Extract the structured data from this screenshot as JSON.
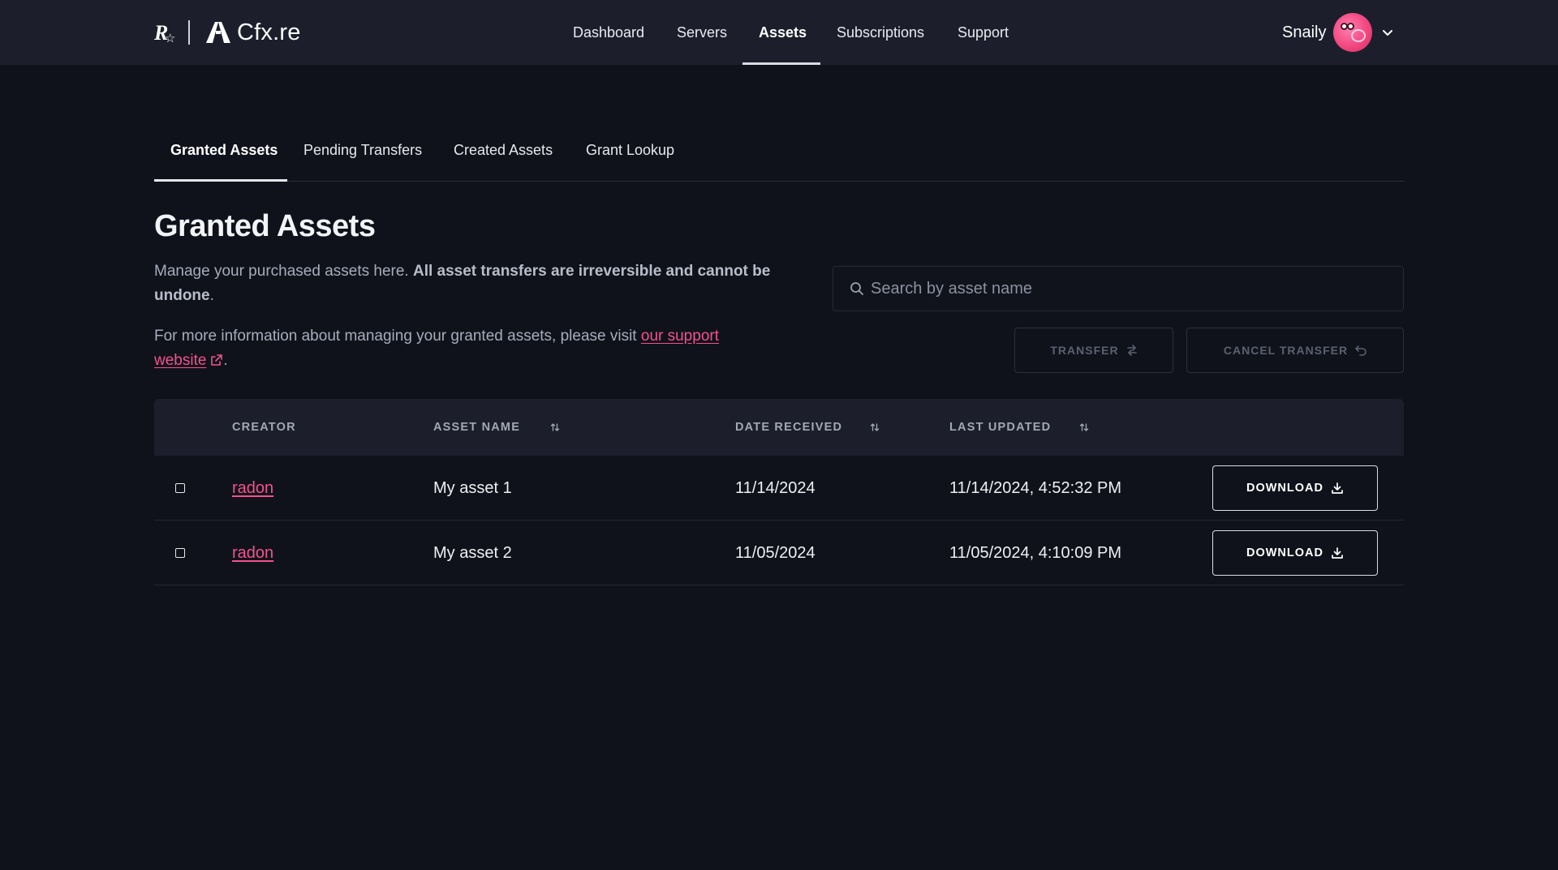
{
  "header": {
    "brand_name": "Cfx.re",
    "nav": [
      {
        "label": "Dashboard",
        "active": false
      },
      {
        "label": "Servers",
        "active": false
      },
      {
        "label": "Assets",
        "active": true
      },
      {
        "label": "Subscriptions",
        "active": false
      },
      {
        "label": "Support",
        "active": false
      }
    ],
    "user_name": "Snaily"
  },
  "subtabs": [
    {
      "label": "Granted Assets",
      "active": true
    },
    {
      "label": "Pending Transfers",
      "active": false
    },
    {
      "label": "Created Assets",
      "active": false
    },
    {
      "label": "Grant Lookup",
      "active": false
    }
  ],
  "page": {
    "title": "Granted Assets",
    "intro_text": "Manage your purchased assets here. ",
    "intro_bold": "All asset transfers are irreversible and cannot be undone",
    "intro_end": ".",
    "info_text": "For more information about managing your granted assets, please visit ",
    "support_link": "our support website",
    "info_end": "."
  },
  "search": {
    "placeholder": "Search by asset name",
    "value": ""
  },
  "actions": {
    "transfer_label": "TRANSFER",
    "cancel_transfer_label": "CANCEL TRANSFER"
  },
  "table": {
    "columns": {
      "creator": "CREATOR",
      "asset_name": "ASSET NAME",
      "date_received": "DATE RECEIVED",
      "last_updated": "LAST UPDATED"
    },
    "rows": [
      {
        "creator": "radon",
        "asset_name": "My asset 1",
        "date_received": "11/14/2024",
        "last_updated": "11/14/2024, 4:52:32 PM",
        "action": "DOWNLOAD"
      },
      {
        "creator": "radon",
        "asset_name": "My asset 2",
        "date_received": "11/05/2024",
        "last_updated": "11/05/2024, 4:10:09 PM",
        "action": "DOWNLOAD"
      }
    ]
  },
  "icons": {
    "search": "search-icon",
    "transfer": "swap-arrows-icon",
    "cancel_transfer": "undo-arrow-icon",
    "sort": "sort-arrows-icon",
    "download": "download-icon",
    "external_link": "external-link-icon",
    "user_menu": "chevron-down-icon"
  },
  "colors": {
    "background": "#10121b",
    "header_bg": "#1c1f2b",
    "accent_link": "#f2528e",
    "muted_text": "#a7acbb"
  }
}
